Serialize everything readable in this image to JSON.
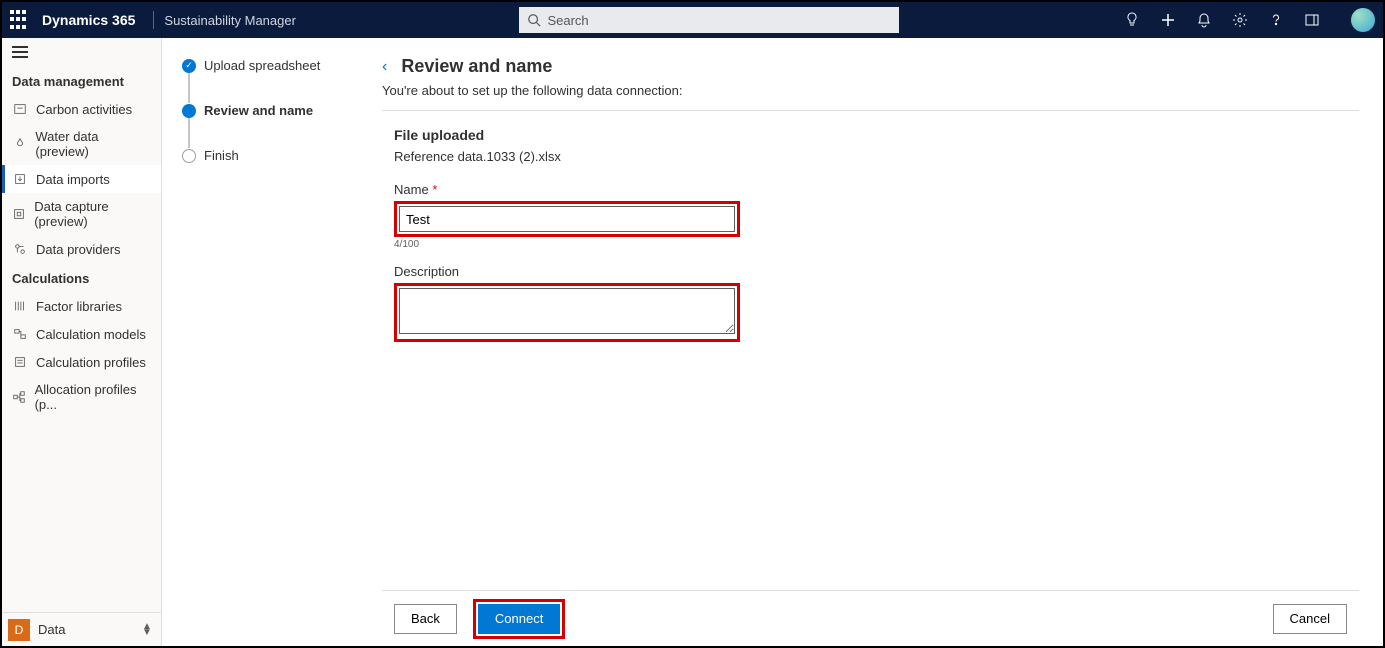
{
  "topbar": {
    "brand": "Dynamics 365",
    "app": "Sustainability Manager",
    "search_placeholder": "Search"
  },
  "leftnav": {
    "sections": {
      "data_mgmt": {
        "title": "Data management",
        "items": [
          "Carbon activities",
          "Water data (preview)",
          "Data imports",
          "Data capture (preview)",
          "Data providers"
        ]
      },
      "calcs": {
        "title": "Calculations",
        "items": [
          "Factor libraries",
          "Calculation models",
          "Calculation profiles",
          "Allocation profiles (p..."
        ]
      }
    },
    "area_badge": "D",
    "area_label": "Data"
  },
  "wizard": {
    "steps": [
      "Upload spreadsheet",
      "Review and name",
      "Finish"
    ]
  },
  "content": {
    "title": "Review and name",
    "subtitle": "You're about to set up the following data connection:",
    "file_heading": "File uploaded",
    "filename": "Reference data.1033 (2).xlsx",
    "name_label": "Name",
    "name_required": "*",
    "name_value": "Test",
    "name_counter": "4/100",
    "desc_label": "Description",
    "desc_value": ""
  },
  "footer": {
    "back": "Back",
    "connect": "Connect",
    "cancel": "Cancel"
  }
}
